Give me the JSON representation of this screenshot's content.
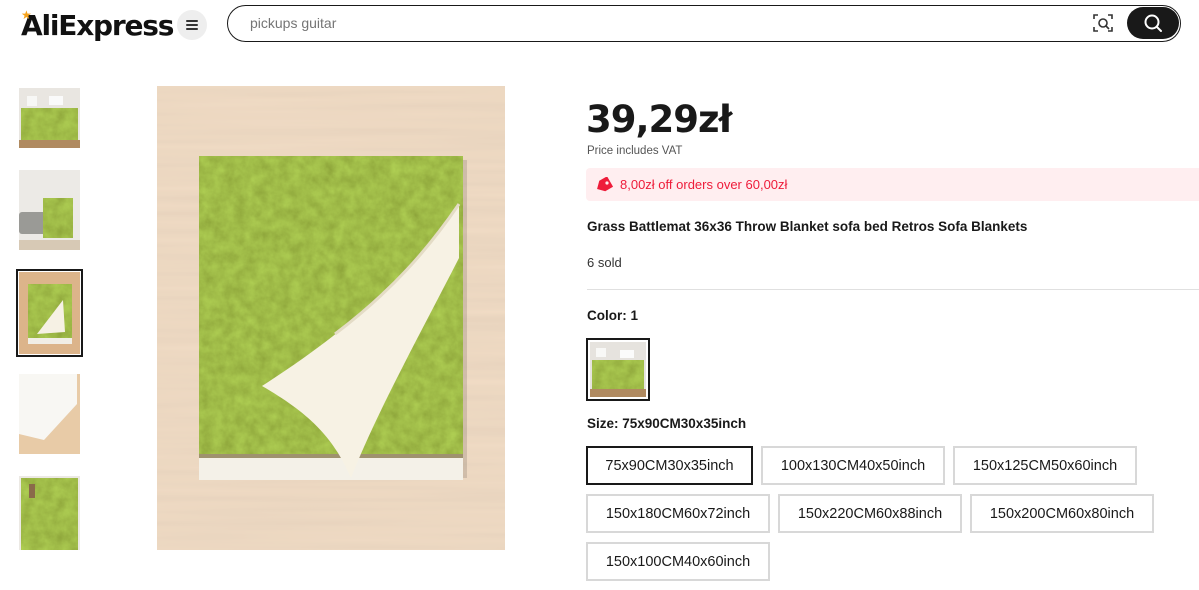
{
  "header": {
    "logo_text": "AliExpress",
    "menu_icon": "hamburger-menu-icon",
    "search_placeholder": "pickups guitar",
    "camera_icon": "camera-search-icon",
    "search_icon": "search-icon"
  },
  "gallery": {
    "thumbnails": [
      "bed-room",
      "sofa-room",
      "blanket-folded",
      "blanket-corner",
      "blanket-hanging"
    ],
    "selected_index": 2
  },
  "product": {
    "price": "39,29zł",
    "vat_note": "Price includes VAT",
    "promo_text": "8,00zł off orders over 60,00zł",
    "promo_icon": "price-tag-icon",
    "title": "Grass Battlemat 36x36 Throw Blanket sofa bed Retros Sofa Blankets",
    "sold": "6 sold",
    "color_label": "Color: 1",
    "size_label": "Size: 75x90CM30x35inch",
    "sizes": [
      "75x90CM30x35inch",
      "100x130CM40x50inch",
      "150x125CM50x60inch",
      "150x180CM60x72inch",
      "150x220CM60x88inch",
      "150x200CM60x80inch",
      "150x100CM40x60inch"
    ],
    "selected_size_index": 0
  },
  "colors": {
    "accent_red": "#ee1c3a",
    "promo_bg": "#ffeef0",
    "dark": "#191919",
    "grass": "#6b8a1e"
  }
}
